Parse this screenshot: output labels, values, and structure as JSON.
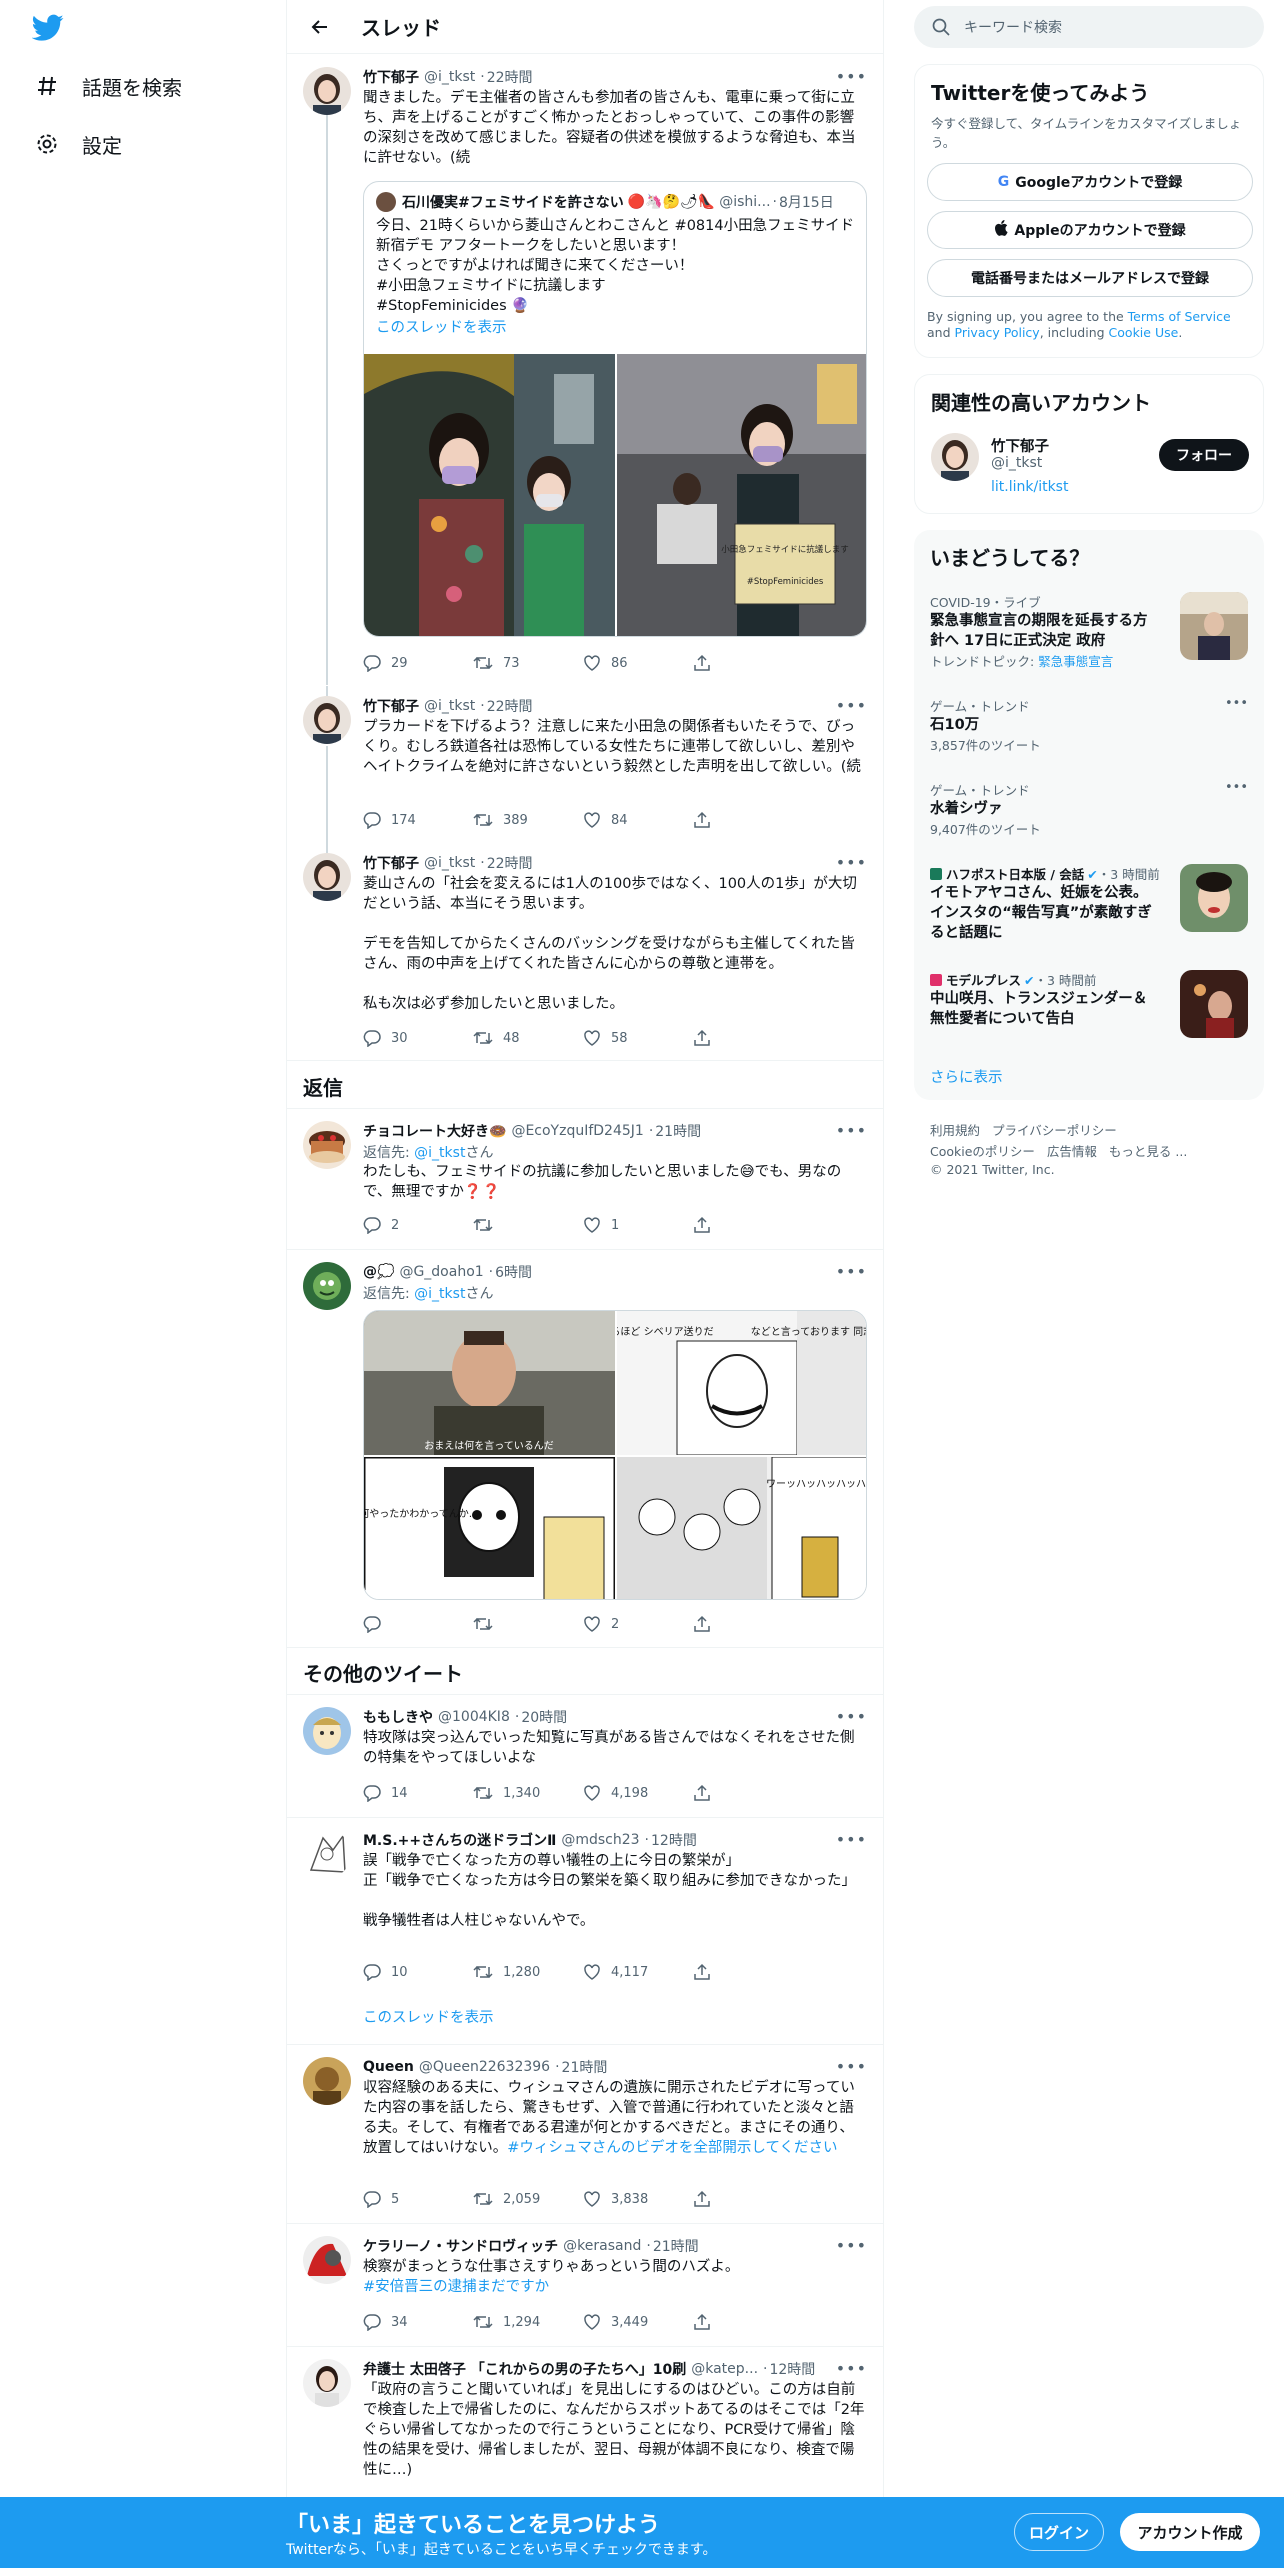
{
  "nav": {
    "explore_label": "話題を検索",
    "settings_label": "設定"
  },
  "header": {
    "title": "スレッド"
  },
  "thread": [
    {
      "name": "竹下郁子",
      "handle": "@i_tkst",
      "time": "22時間",
      "text": "聞きました。デモ主催者の皆さんも参加者の皆さんも、電車に乗って街に立ち、声を上げることがすごく怖かったとおっしゃっていて、この事件の影響の深刻さを改めて感じました。容疑者の供述を模倣するような脅迫も、本当に許せない。(続",
      "quote": {
        "name": "石川優実#フェミサイドを許さない",
        "emoji": "🔴🦄🤔🌶👠",
        "handle": "@ishi...",
        "date": "8月15日",
        "text": "今日、21時くらいから菱山さんとわこさんと #0814小田急フェミサイド新宿デモ アフタートークをしたいと思います！\nさくっとですがよければ聞きに来てくださーい！\n#小田急フェミサイドに抗議します\n#StopFeminicides 🔮",
        "show_thread": "このスレッドを表示",
        "sign_text": "小田急フェミサイドに抗議します",
        "sign_text2": "#StopFeminicides"
      },
      "replies": "29",
      "retweets": "73",
      "likes": "86"
    },
    {
      "name": "竹下郁子",
      "handle": "@i_tkst",
      "time": "22時間",
      "text": "プラカードを下げるよう？注意しに来た小田急の関係者もいたそうで、びっくり。むしろ鉄道各社は恐怖している女性たちに連帯して欲しいし、差別やヘイトクライムを絶対に許さないという毅然とした声明を出して欲しい。(続",
      "replies": "174",
      "retweets": "389",
      "likes": "84"
    },
    {
      "name": "竹下郁子",
      "handle": "@i_tkst",
      "time": "22時間",
      "text": "菱山さんの「社会を変えるには1人の100歩ではなく、100人の1歩」が大切だという話、本当にそう思います。\n\nデモを告知してからたくさんのバッシングを受けながらも主催してくれた皆さん、雨の中声を上げてくれた皆さんに心からの尊敬と連帯を。\n\n私も次は必ず参加したいと思いました。",
      "replies": "30",
      "retweets": "48",
      "likes": "58"
    }
  ],
  "replies_section": {
    "title": "返信"
  },
  "replies": [
    {
      "name": "チョコレート大好き🍩",
      "handle": "@EcoYzquIfD245J1",
      "time": "21時間",
      "reply_to_prefix": "返信先: ",
      "reply_to_handle": "@i_tkst",
      "reply_to_suffix": "さん",
      "text": "わたしも、フェミサイドの抗議に参加したいと思いました😅でも、男なので、無理ですか❓❓",
      "replies": "2",
      "retweets": "",
      "likes": "1"
    },
    {
      "name": "@💭",
      "handle": "@G_doaho1",
      "time": "6時間",
      "reply_to_prefix": "返信先: ",
      "reply_to_handle": "@i_tkst",
      "reply_to_suffix": "さん",
      "text": "",
      "manga_text_1": "なるほど シベリア送りだ",
      "manga_text_2": "などと言っております 同志スターリン",
      "manga_text_3": "自分が何やったかわかってんか…",
      "manga_text_4": "ワーッハッハッハッハ!!",
      "photo_caption": "おまえは何を言っているんだ",
      "replies": "",
      "retweets": "",
      "likes": "2"
    }
  ],
  "more_section": {
    "title": "その他のツイート"
  },
  "more": [
    {
      "name": "ももしきや",
      "handle": "@1004KI8",
      "time": "20時間",
      "text": "特攻隊は突っ込んでいった知覧に写真がある皆さんではなくそれをさせた側の特集をやってほしいよな",
      "replies": "14",
      "retweets": "1,340",
      "likes": "4,198"
    },
    {
      "name": "M.S.++さんちの迷ドラゴンⅡ",
      "handle": "@mdsch23",
      "time": "12時間",
      "text": "誤「戦争で亡くなった方の尊い犠牲の上に今日の繁栄が」\n正「戦争で亡くなった方は今日の繁栄を築く取り組みに参加できなかった」\n\n戦争犠牲者は人柱じゃないんやで。",
      "replies": "10",
      "retweets": "1,280",
      "likes": "4,117",
      "show_thread": "このスレッドを表示"
    },
    {
      "name": "Queen",
      "handle": "@Queen22632396",
      "time": "21時間",
      "text": "収容経験のある夫に、ウィシュマさんの遺族に開示されたビデオに写っていた内容の事を話したら、驚きもせず、入管で普通に行われていたと淡々と語る夫。そして、有権者である君達が何とかするべきだと。まさにその通り、放置してはいけない。",
      "hashtag": "#ウィシュマさんのビデオを全部開示してください",
      "replies": "5",
      "retweets": "2,059",
      "likes": "3,838"
    },
    {
      "name": "ケラリーノ・サンドロヴィッチ",
      "handle": "@kerasand",
      "time": "21時間",
      "text": "検察がまっとうな仕事さえすりゃあっという間のハズよ。",
      "hashtag": "#安倍晋三の逮捕まだですか",
      "replies": "34",
      "retweets": "1,294",
      "likes": "3,449"
    },
    {
      "name": "弁護士 太田啓子 「これからの男の子たちへ」10刷",
      "handle": "@katep...",
      "time": "12時間",
      "text": "「政府の言うこと聞いていれば」を見出しにするのはひどい。この方は自前で検査した上で帰省したのに、なんだからスポットあてるのはそこでは「2年ぐらい帰省してなかったので行こうということになり、PCR受けて帰省」陰性の結果を受け、帰省しましたが、翌日、母親が体調不良になり、検査で陽性に…)"
    }
  ],
  "sidebar": {
    "search_placeholder": "キーワード検索",
    "signup": {
      "title": "Twitterを使ってみよう",
      "subtitle": "今すぐ登録して、タイムラインをカスタマイズしましょう。",
      "google": "Googleアカウントで登録",
      "apple": "Appleのアカウントで登録",
      "phone": "電話番号またはメールアドレスで登録",
      "legal_1": "By signing up, you agree to the ",
      "legal_tos": "Terms of Service",
      "legal_2": " and ",
      "legal_pp": "Privacy Policy",
      "legal_3": ", including ",
      "legal_cookie": "Cookie Use",
      "legal_4": "."
    },
    "relevant": {
      "title": "関連性の高いアカウント",
      "name": "竹下郁子",
      "handle": "@i_tkst",
      "link": "lit.link/itkst",
      "follow": "フォロー"
    },
    "trends": {
      "title": "いまどうしてる？",
      "items": [
        {
          "meta": "COVID-19・ライブ",
          "name": "緊急事態宣言の期限を延長する方針へ 17日に正式決定 政府",
          "sub_prefix": "トレンドトピック: ",
          "sub_link": "緊急事態宣言"
        },
        {
          "meta": "ゲーム・トレンド",
          "name": "石10万",
          "sub": "3,857件のツイート"
        },
        {
          "meta": "ゲーム・トレンド",
          "name": "水着シヴァ",
          "sub": "9,407件のツイート"
        },
        {
          "meta_source": "ハフポスト日本版 / 会話",
          "meta_time": "・3 時間前",
          "name": "イモトアヤコさん、妊娠を公表。インスタの“報告写真”が素敵すぎると話題に"
        },
        {
          "meta_source": "モデルプレス",
          "meta_time": "・3 時間前",
          "name": "中山咲月、トランスジェンダー＆無性愛者について告白"
        }
      ],
      "more": "さらに表示"
    },
    "footer": {
      "line1": [
        "利用規約",
        "プライバシーポリシー"
      ],
      "line2": [
        "Cookieのポリシー",
        "広告情報",
        "もっと見る ..."
      ],
      "copyright": "© 2021 Twitter, Inc."
    }
  },
  "banner": {
    "title": "「いま」起きていることを見つけよう",
    "subtitle": "Twitterなら、「いま」起きていることをいち早くチェックできます。",
    "login": "ログイン",
    "signup": "アカウント作成"
  },
  "colors": {
    "accent": "#1d9bf0",
    "text": "#0f1419",
    "muted": "#536471"
  }
}
